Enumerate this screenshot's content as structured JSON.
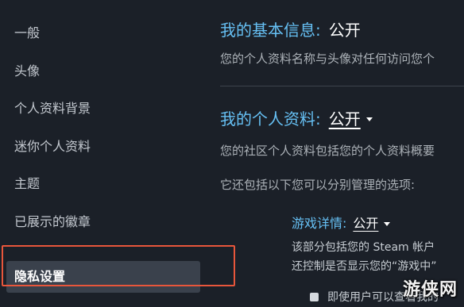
{
  "sidebar": {
    "items": [
      {
        "label": "一般"
      },
      {
        "label": "头像"
      },
      {
        "label": "个人资料背景"
      },
      {
        "label": "迷你个人资料"
      },
      {
        "label": "主题"
      },
      {
        "label": "已展示的徽章"
      },
      {
        "label": "隐私设置",
        "active": true
      }
    ]
  },
  "basic_info": {
    "title": "我的基本信息:",
    "value": "公开",
    "description": "您的个人资料名称与头像对任何访问您个"
  },
  "profile": {
    "title": "我的个人资料:",
    "value": "公开",
    "description": "您的社区个人资料包括您的个人资料概要",
    "note": "它还包括以下您可以分别管理的选项:"
  },
  "game_details": {
    "title": "游戏详情:",
    "value": "公开",
    "description_line1": "该部分包括您的 Steam 帐户",
    "description_line2": "还控制是否显示您的“游戏中”",
    "checkbox_label": "即使用户可以查看我的",
    "checkbox_checked": false
  },
  "watermark": {
    "text": "游侠网"
  },
  "icons": {
    "dropdown": "chevron-down-icon",
    "checkbox": "checkbox-icon"
  },
  "colors": {
    "background": "#1b2028",
    "accent_blue": "#66c0f4",
    "active_item_bg": "#3a414c",
    "callout_border": "#e8563b",
    "text_muted": "#acb2b8"
  }
}
